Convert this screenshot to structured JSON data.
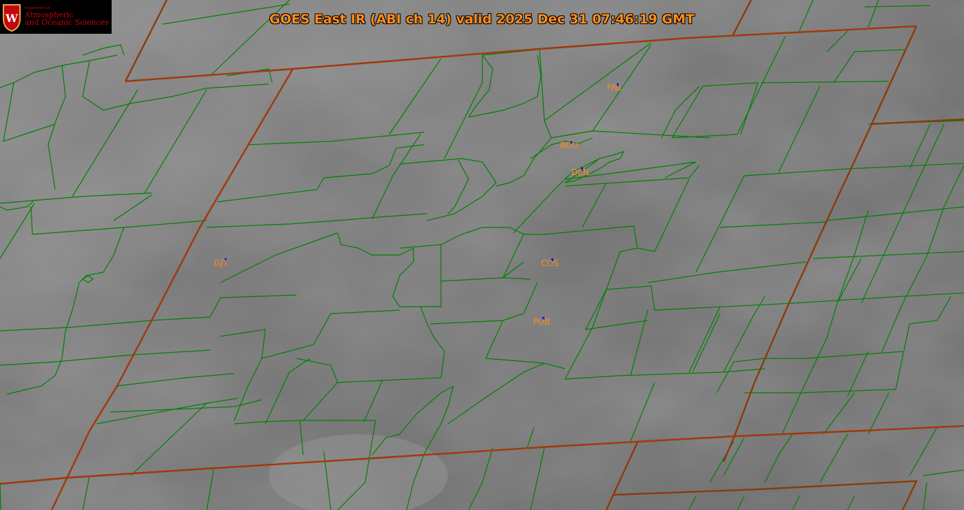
{
  "title": "GOES East IR (ABI ch 14) valid 2025 Dec 31 07:46:19 GMT",
  "logo": {
    "department": "Department of",
    "line1": "Atmospheric",
    "line2": "and Oceanic Sciences",
    "seal_letter": "W"
  },
  "stations": [
    {
      "id": "FNL",
      "label": "FNL"
    },
    {
      "id": "BOU",
      "label": "BOU"
    },
    {
      "id": "DEN",
      "label": "DEN"
    },
    {
      "id": "GJT",
      "label": "GJT"
    },
    {
      "id": "COS",
      "label": "COS"
    },
    {
      "id": "PUB",
      "label": "PUB"
    }
  ],
  "colors": {
    "state_border": "#8b3a0a",
    "county_border": "#008000",
    "label": "#ff8c1a",
    "station_marker": "#0000ff",
    "logo_red": "#c5050c"
  }
}
